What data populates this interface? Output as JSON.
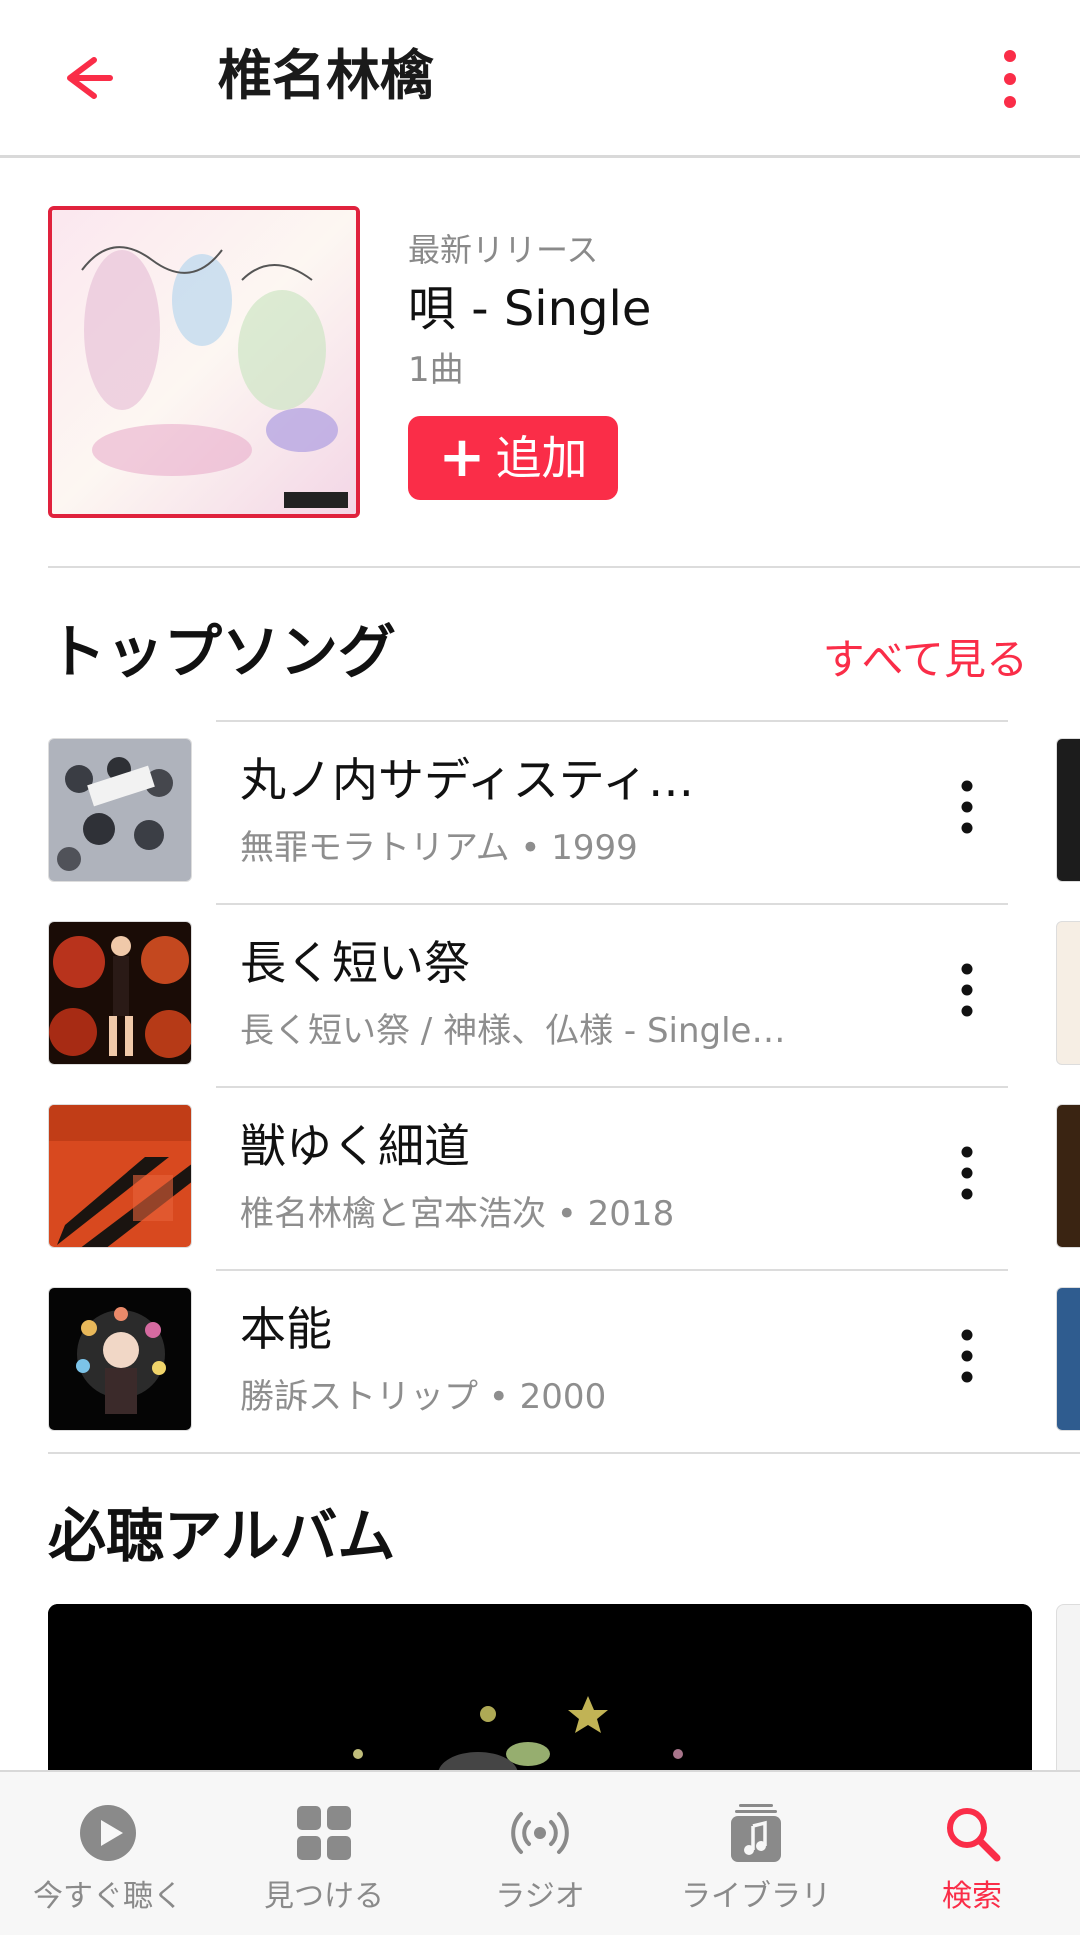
{
  "header": {
    "title": "椎名林檎",
    "back_icon": "arrow-left-icon",
    "more_icon": "vertical-dots-icon"
  },
  "latest_release": {
    "kicker": "最新リリース",
    "title": "唄 - Single",
    "count": "1曲",
    "add_icon": "plus-icon",
    "add_label": "追加"
  },
  "top_songs": {
    "heading": "トップソング",
    "see_all": "すべて見る",
    "items": [
      {
        "title": "丸ノ内サディスティ…",
        "subtitle": "無罪モラトリアム • 1999"
      },
      {
        "title": "長く短い祭",
        "subtitle": "長く短い祭 / 神様、仏様 - Single…"
      },
      {
        "title": "獣ゆく細道",
        "subtitle": "椎名林檎と宮本浩次 • 2018"
      },
      {
        "title": "本能",
        "subtitle": "勝訴ストリップ • 2000"
      }
    ]
  },
  "essential_albums": {
    "heading": "必聴アルバム"
  },
  "tabbar": {
    "items": [
      {
        "label": "今すぐ聴く",
        "icon": "play-circle-icon"
      },
      {
        "label": "見つける",
        "icon": "grid-icon"
      },
      {
        "label": "ラジオ",
        "icon": "radio-waves-icon"
      },
      {
        "label": "ライブラリ",
        "icon": "music-library-icon"
      },
      {
        "label": "検索",
        "icon": "search-icon"
      }
    ],
    "active": "検索"
  },
  "colors": {
    "accent": "#fa2d48",
    "secondary_text": "#8e8e8e",
    "divider": "#dcdcdc"
  }
}
